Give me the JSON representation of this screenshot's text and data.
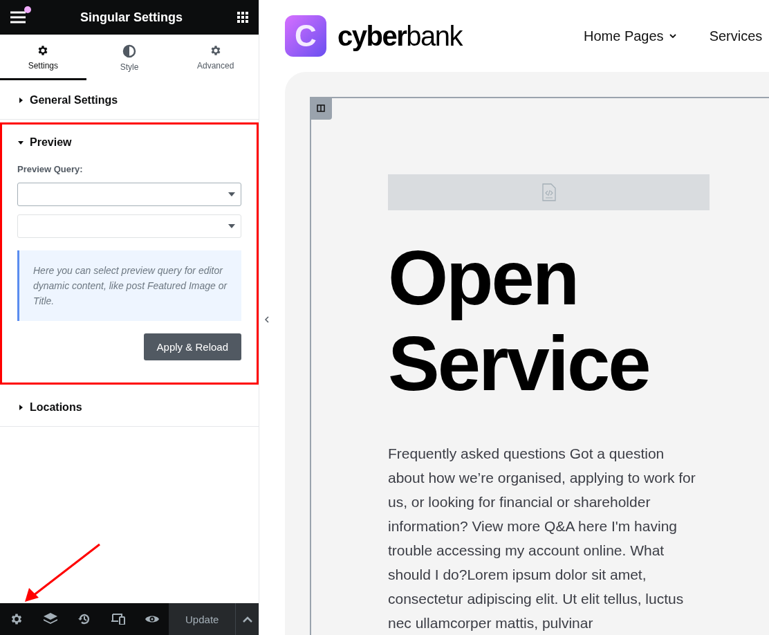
{
  "panel": {
    "title": "Singular Settings",
    "notification": true,
    "tabs": [
      {
        "label": "Settings",
        "selected": true
      },
      {
        "label": "Style",
        "selected": false
      },
      {
        "label": "Advanced",
        "selected": false
      }
    ],
    "sections": [
      {
        "title": "General Settings",
        "expanded": false,
        "highlighted": false
      },
      {
        "title": "Preview",
        "expanded": true,
        "highlighted": true,
        "query_label": "Preview Query:",
        "note": "Here you can select preview query for editor dynamic content, like post Featured Image or Title.",
        "button": "Apply & Reload"
      },
      {
        "title": "Locations",
        "expanded": false,
        "highlighted": false
      }
    ],
    "footer": {
      "update": "Update"
    }
  },
  "site": {
    "logo_letter": "C",
    "brand_bold": "cyber",
    "brand_light": "bank",
    "nav": [
      {
        "label": "Home Pages",
        "dropdown": true
      },
      {
        "label": "Services",
        "dropdown": false
      }
    ],
    "heading_lines": [
      "Open",
      "Service"
    ],
    "paragraph": "Frequently asked questions Got a question about how we’re organised, applying to work for us, or looking for financial or shareholder information? View more Q&A here I'm having trouble accessing my account online. What should I do?Lorem ipsum dolor sit amet, consectetur adipiscing elit. Ut elit tellus, luctus nec ullamcorper mattis, pulvinar"
  }
}
